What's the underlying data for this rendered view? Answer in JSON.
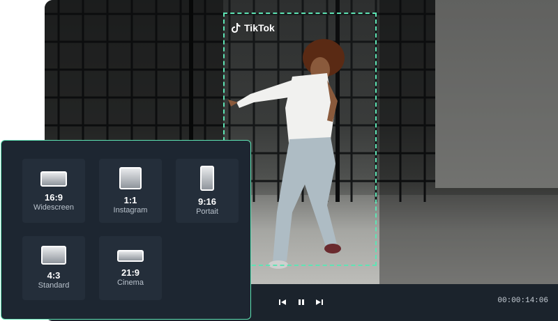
{
  "player": {
    "platform_badge": {
      "label": "TikTok",
      "icon": "tiktok-icon"
    },
    "controls": {
      "prev_icon": "skip-back-icon",
      "pause_icon": "pause-icon",
      "next_icon": "skip-forward-icon",
      "timecode": "00:00:14:06"
    },
    "colors": {
      "accent": "#5ee4b4",
      "panel": "#1d2631",
      "bar": "#1b232c"
    }
  },
  "aspect_ratios": [
    {
      "ratio": "16:9",
      "name": "Widescreen",
      "icon": "landscape-rect-icon"
    },
    {
      "ratio": "1:1",
      "name": "Instagram",
      "icon": "square-icon"
    },
    {
      "ratio": "9:16",
      "name": "Portait",
      "icon": "portrait-rect-icon"
    },
    {
      "ratio": "4:3",
      "name": "Standard",
      "icon": "standard-rect-icon"
    },
    {
      "ratio": "21:9",
      "name": "Cinema",
      "icon": "cinema-rect-icon"
    }
  ]
}
